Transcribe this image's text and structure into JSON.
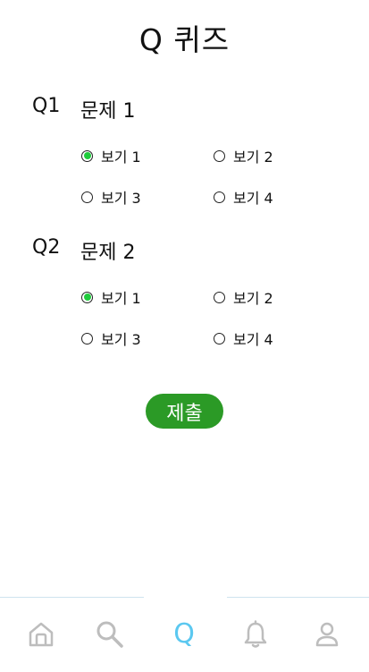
{
  "header": {
    "title": "Q 퀴즈"
  },
  "questions": [
    {
      "number": "Q1",
      "text": "문제 1",
      "options": [
        "보기 1",
        "보기 2",
        "보기 3",
        "보기 4"
      ],
      "selected_option": "보기 1"
    },
    {
      "number": "Q2",
      "text": "문제 2",
      "options": [
        "보기 1",
        "보기 2",
        "보기 3",
        "보기 4"
      ],
      "selected_option": "보기 1"
    }
  ],
  "submit": {
    "label": "제출"
  },
  "tabbar": {
    "active_tab": "quiz",
    "tabs": [
      {
        "icon": "home-icon"
      },
      {
        "icon": "search-icon"
      },
      {
        "icon": "quiz-q-icon",
        "glyph": "Q"
      },
      {
        "icon": "bell-icon"
      },
      {
        "icon": "profile-icon"
      }
    ]
  },
  "colors": {
    "accent_button": "#2b9a26",
    "radio_selected": "#1fcc3c",
    "tab_active": "#5bc8f0",
    "tab_inactive": "#bdbdbd"
  }
}
